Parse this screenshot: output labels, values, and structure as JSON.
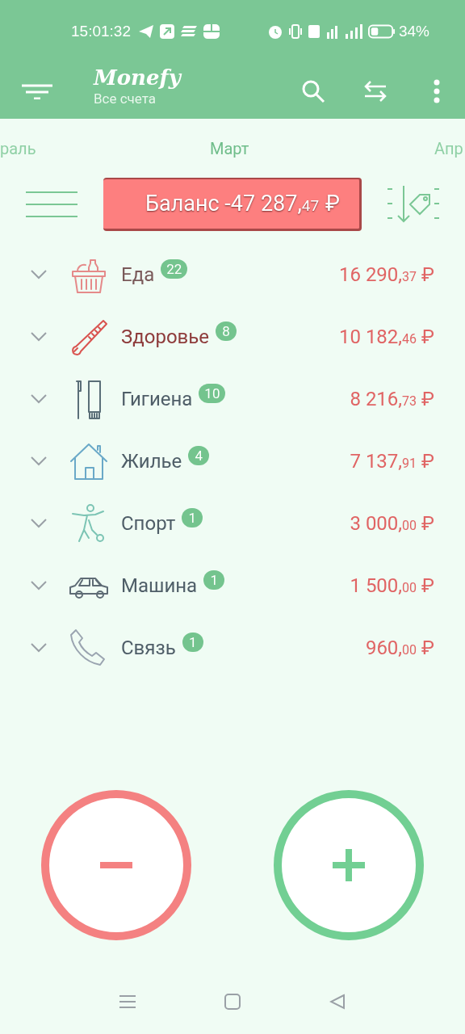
{
  "status_bar": {
    "time": "15:01:32",
    "battery": "34%"
  },
  "app_bar": {
    "title": "Monefy",
    "subtitle": "Все счета"
  },
  "months": [
    {
      "label": "раль",
      "selected": false
    },
    {
      "label": "Март",
      "selected": true
    },
    {
      "label": "Апр",
      "selected": false
    }
  ],
  "balance": {
    "label": "Баланс -47 287,",
    "cents": "47",
    "currency": "₽"
  },
  "categories": [
    {
      "kind": "basket",
      "name": "Еда",
      "count": "22",
      "amount": "16 290,",
      "cents": "37",
      "currency": "₽",
      "color": "#e58a8a"
    },
    {
      "kind": "thermometer",
      "name": "Здоровье",
      "count": "8",
      "amount": "10 182,",
      "cents": "46",
      "currency": "₽",
      "color": "#d9534f"
    },
    {
      "kind": "toothbrush",
      "name": "Гигиена",
      "count": "10",
      "amount": "8 216,",
      "cents": "73",
      "currency": "₽",
      "color": "#5a6e78"
    },
    {
      "kind": "house",
      "name": "Жилье",
      "count": "4",
      "amount": "7 137,",
      "cents": "91",
      "currency": "₽",
      "color": "#6aa9c8"
    },
    {
      "kind": "soccer",
      "name": "Спорт",
      "count": "1",
      "amount": "3 000,",
      "cents": "00",
      "currency": "₽",
      "color": "#7cc4b4"
    },
    {
      "kind": "car",
      "name": "Машина",
      "count": "1",
      "amount": "1 500,",
      "cents": "00",
      "currency": "₽",
      "color": "#5e6b75"
    },
    {
      "kind": "phone",
      "name": "Связь",
      "count": "1",
      "amount": "960,",
      "cents": "00",
      "currency": "₽",
      "color": "#9aa4b0"
    }
  ]
}
